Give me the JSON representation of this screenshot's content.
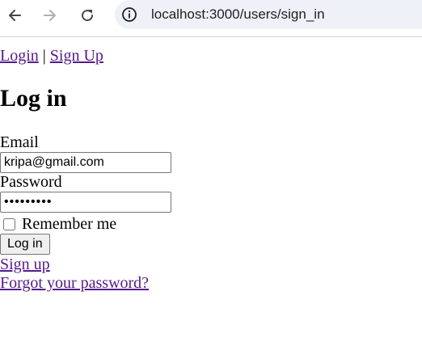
{
  "browser": {
    "url": "localhost:3000/users/sign_in",
    "back_icon": "back-arrow-icon",
    "forward_icon": "forward-arrow-icon",
    "reload_icon": "reload-icon",
    "site_info_icon": "info-icon"
  },
  "nav": {
    "login_label": "Login",
    "separator": " | ",
    "signup_label": "Sign Up"
  },
  "form": {
    "title": "Log in",
    "email_label": "Email",
    "email_value": "kripa@gmail.com",
    "password_label": "Password",
    "password_value": "•••••••••",
    "remember_label": "Remember me",
    "remember_checked": false,
    "submit_label": "Log in"
  },
  "links": {
    "sign_up": "Sign up",
    "forgot_password": "Forgot your password?"
  },
  "colors": {
    "link": "#551a8b",
    "omnibox_bg": "#eef1f8"
  }
}
